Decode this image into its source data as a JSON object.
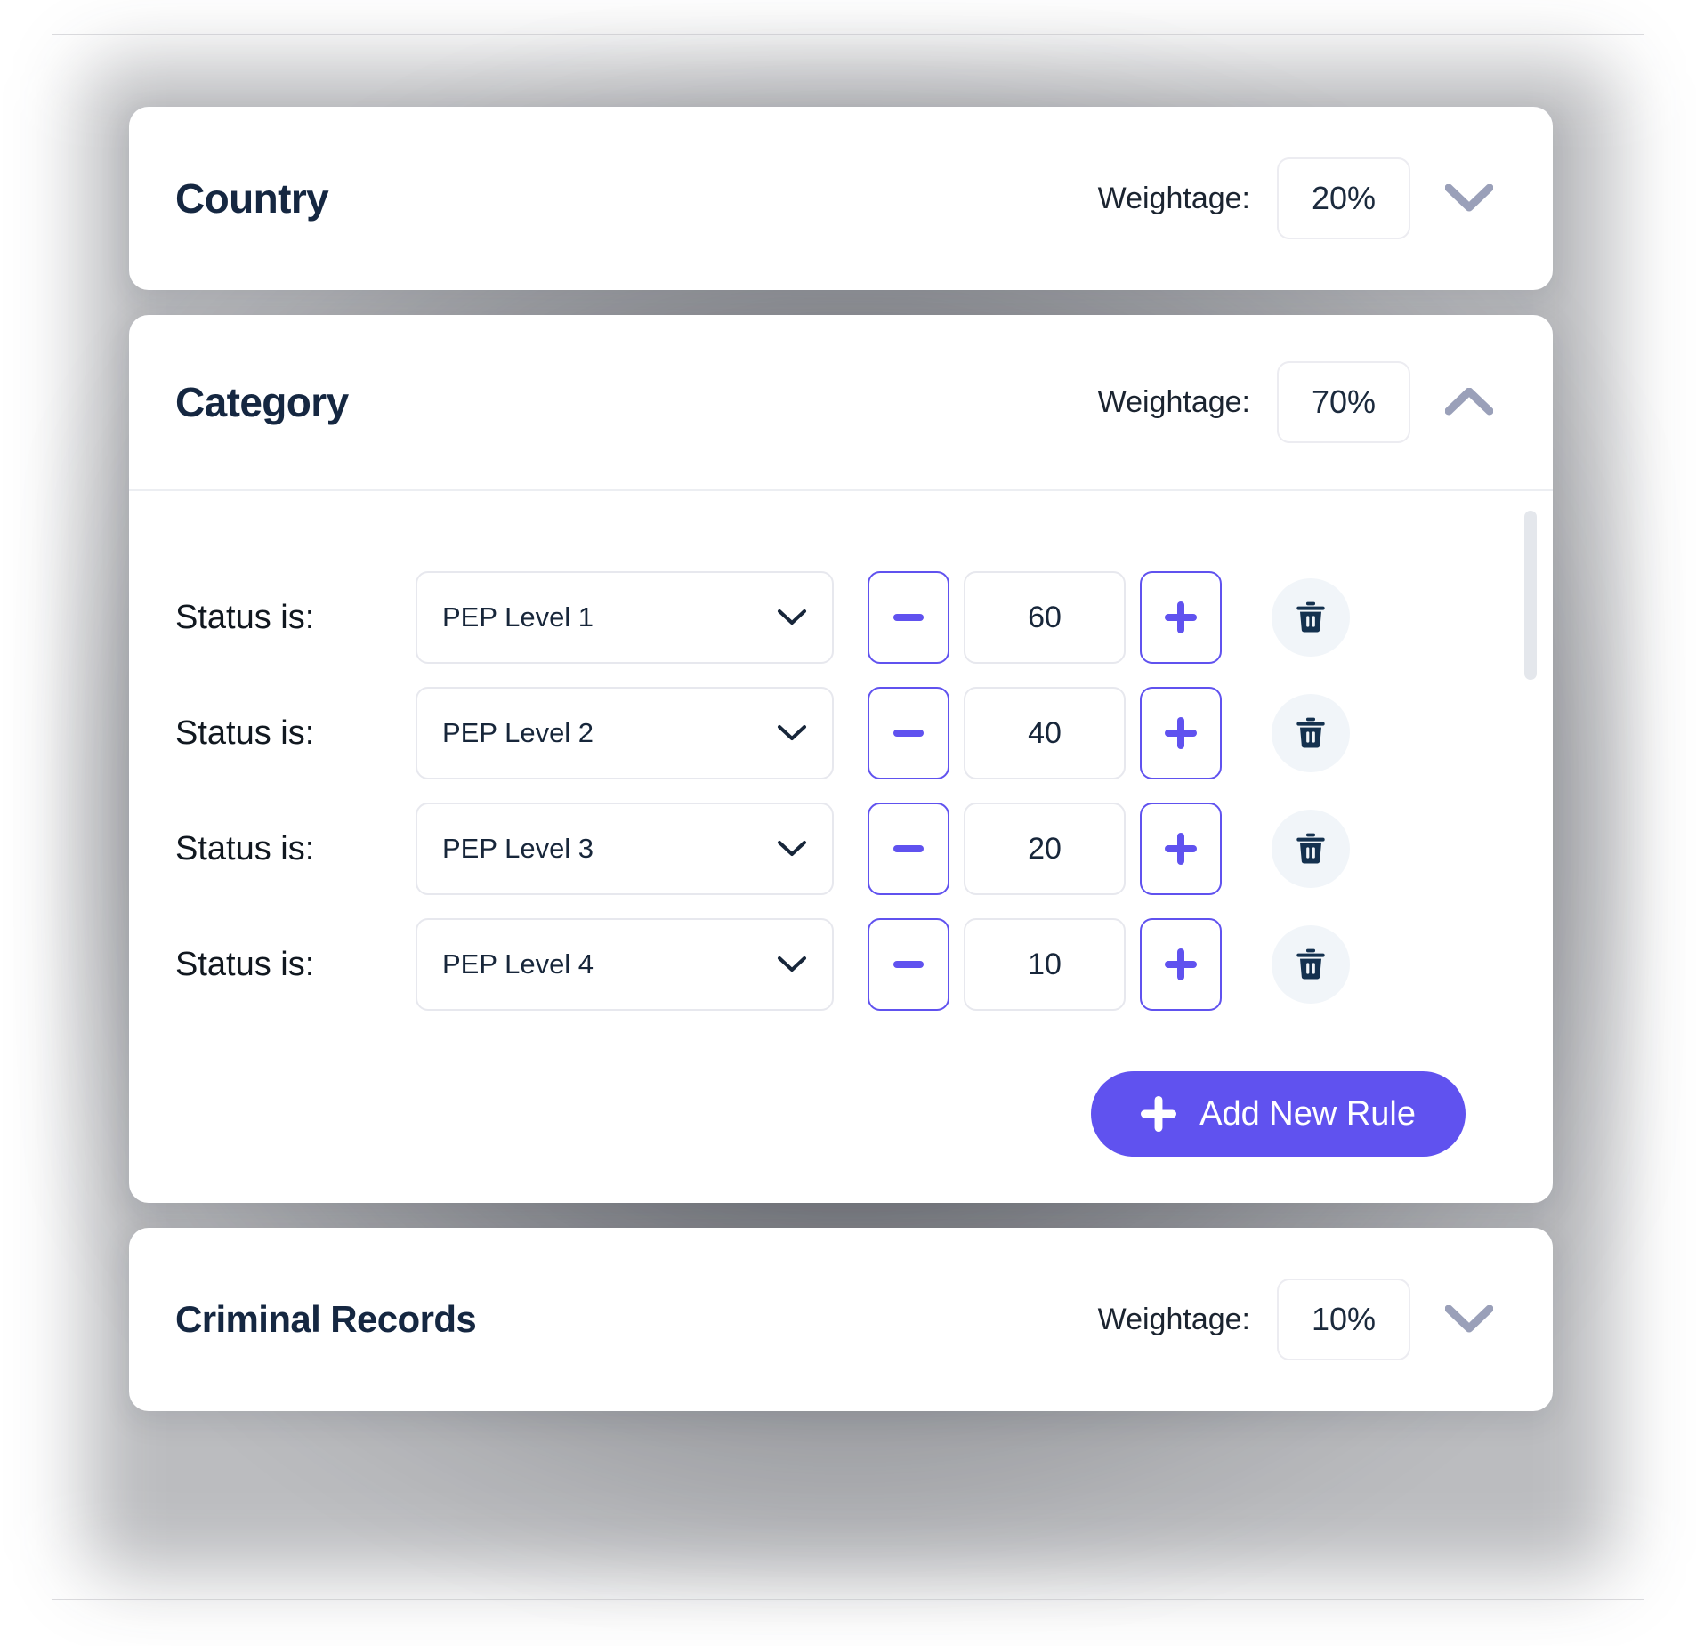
{
  "theme": {
    "accent": "#6052ef",
    "title_color": "#152741",
    "badge_border": "#ececf1",
    "chevron_color": "#9aa0b9",
    "trash_color": "#14314f",
    "trash_bg": "#f1f5f9"
  },
  "common": {
    "weightage_label": "Weightage:"
  },
  "sections": [
    {
      "id": "country",
      "title": "Country",
      "weightage": "20%",
      "expanded": false,
      "chevron_icon": "chevron-down-icon"
    },
    {
      "id": "category",
      "title": "Category",
      "weightage": "70%",
      "expanded": true,
      "chevron_icon": "chevron-up-icon"
    },
    {
      "id": "criminal-records",
      "title": "Criminal Records",
      "weightage": "10%",
      "expanded": false,
      "chevron_icon": "chevron-down-icon"
    }
  ],
  "category_body": {
    "rules": [
      {
        "condition_label": "Status is:",
        "selected_option": "PEP Level 1",
        "score": "60",
        "decrement_label": "−",
        "increment_label": "+",
        "delete_icon": "trash-icon"
      },
      {
        "condition_label": "Status is:",
        "selected_option": "PEP Level 2",
        "score": "40",
        "decrement_label": "−",
        "increment_label": "+",
        "delete_icon": "trash-icon"
      },
      {
        "condition_label": "Status is:",
        "selected_option": "PEP Level 3",
        "score": "20",
        "decrement_label": "−",
        "increment_label": "+",
        "delete_icon": "trash-icon"
      },
      {
        "condition_label": "Status is:",
        "selected_option": "PEP Level 4",
        "score": "10",
        "decrement_label": "−",
        "increment_label": "+",
        "delete_icon": "trash-icon"
      }
    ],
    "add_rule_label": "Add New Rule",
    "add_rule_icon": "plus-icon"
  }
}
